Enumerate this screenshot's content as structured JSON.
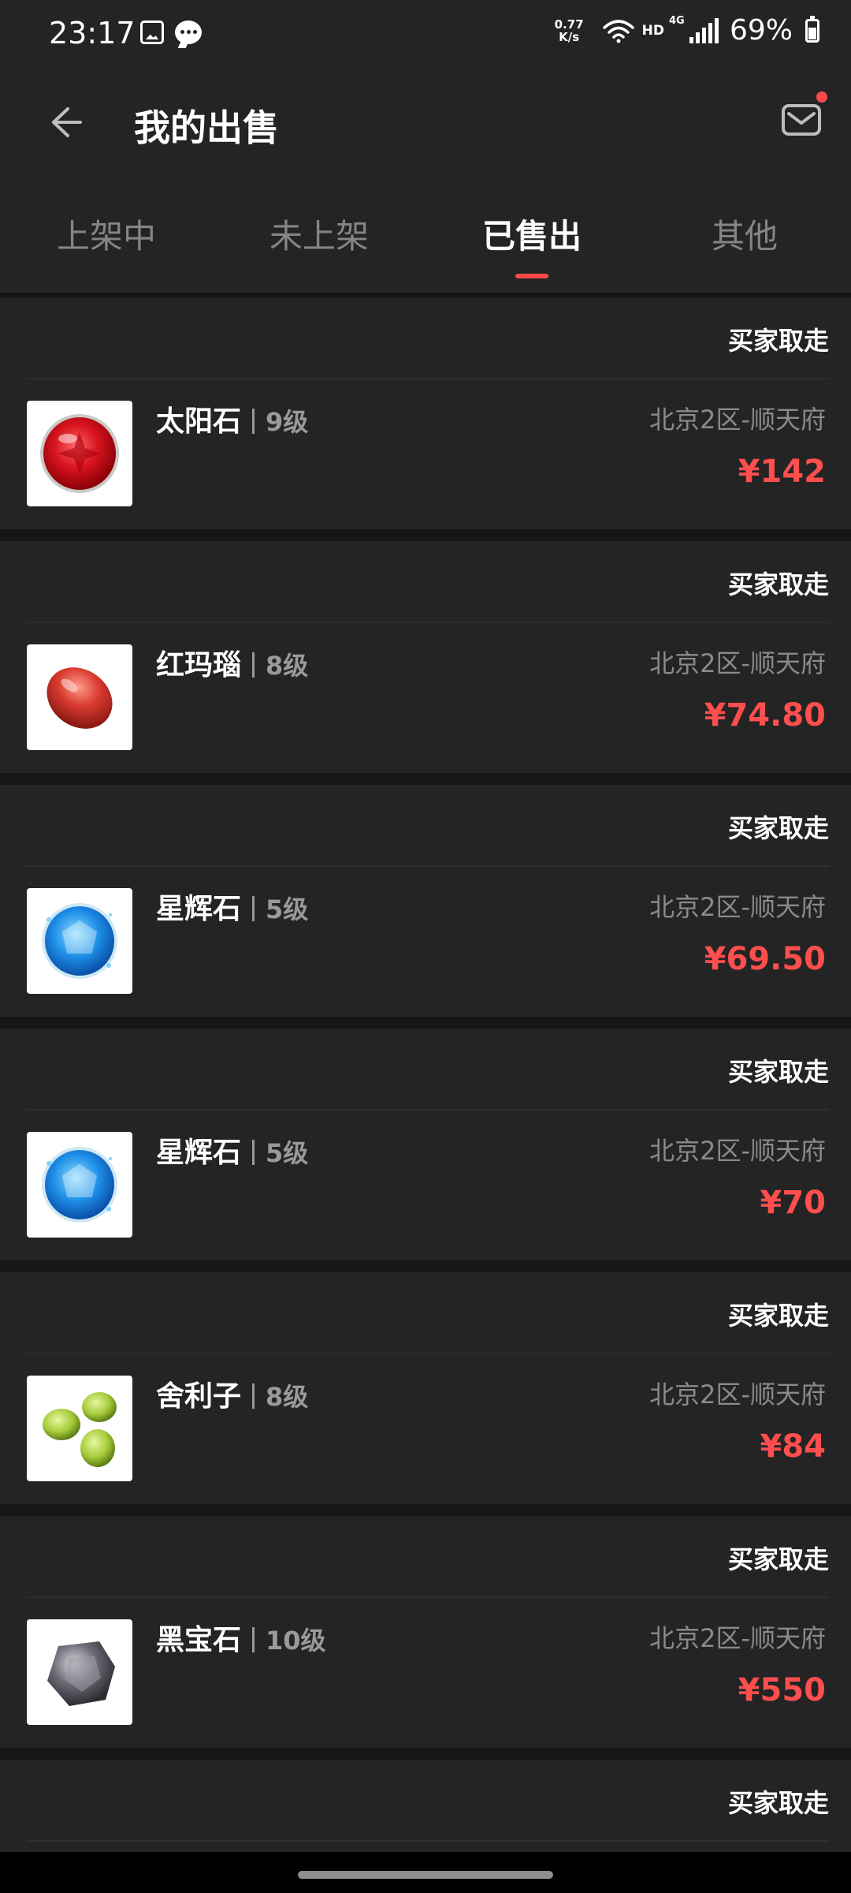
{
  "status_bar": {
    "time": "23:17",
    "net_speed_value": "0.77",
    "net_speed_unit": "K/s",
    "hd_label": "HD",
    "network_label": "4G",
    "battery": "69%",
    "icons": [
      "gallery-icon",
      "chat-icon",
      "wifi-icon",
      "signal-icon",
      "battery-icon"
    ]
  },
  "header": {
    "title": "我的出售",
    "back_icon": "arrow-left-icon",
    "mail_icon": "mail-icon",
    "mail_has_badge": true
  },
  "tabs": [
    {
      "label": "上架中",
      "active": false
    },
    {
      "label": "未上架",
      "active": false
    },
    {
      "label": "已售出",
      "active": true
    },
    {
      "label": "其他",
      "active": false
    }
  ],
  "items": [
    {
      "status": "买家取走",
      "name": "太阳石",
      "level": "9级",
      "server": "北京2区-顺天府",
      "price": "¥142",
      "icon": "sun-stone-icon"
    },
    {
      "status": "买家取走",
      "name": "红玛瑙",
      "level": "8级",
      "server": "北京2区-顺天府",
      "price": "¥74.80",
      "icon": "red-agate-icon"
    },
    {
      "status": "买家取走",
      "name": "星辉石",
      "level": "5级",
      "server": "北京2区-顺天府",
      "price": "¥69.50",
      "icon": "star-stone-icon"
    },
    {
      "status": "买家取走",
      "name": "星辉石",
      "level": "5级",
      "server": "北京2区-顺天府",
      "price": "¥70",
      "icon": "star-stone-icon"
    },
    {
      "status": "买家取走",
      "name": "舍利子",
      "level": "8级",
      "server": "北京2区-顺天府",
      "price": "¥84",
      "icon": "sarira-icon"
    },
    {
      "status": "买家取走",
      "name": "黑宝石",
      "level": "10级",
      "server": "北京2区-顺天府",
      "price": "¥550",
      "icon": "black-gem-icon"
    },
    {
      "status": "买家取走"
    }
  ],
  "colors": {
    "background": "#161616",
    "surface": "#242424",
    "accent": "#ff4a4a",
    "price": "#ff4e4e",
    "muted_text": "#8a8a8a"
  }
}
